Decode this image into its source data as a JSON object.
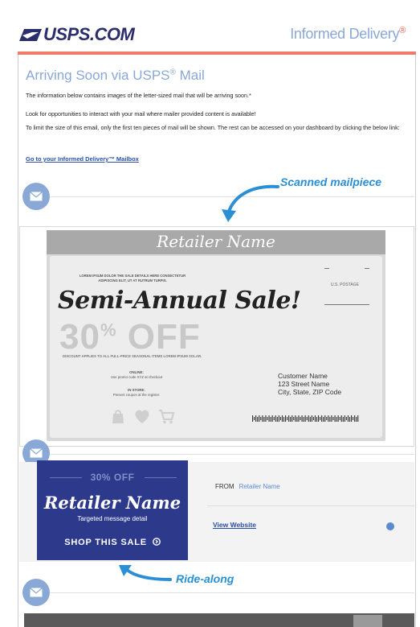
{
  "header": {
    "logo_text": "USPS.COM",
    "brand": "Informed Delivery",
    "brand_mark": "®"
  },
  "email": {
    "title": "Arriving Soon via USPS",
    "title_mark": "®",
    "title_suffix": " Mail",
    "paragraphs": [
      "The information below contains images of the letter-sized mail that will be arriving soon.*",
      "Look for opportunities to interact with your mail where mailer provided content is available!",
      "To limit the size of this email, only the first ten pieces of mail will be shown. The rest can be accessed on your dashboard by clicking the below link:"
    ],
    "mailbox_link": "Go to your Informed Delivery™ Mailbox"
  },
  "callouts": {
    "scanned": "Scanned mailpiece",
    "ridealong": "Ride-along"
  },
  "mailpiece": {
    "retailer_header": "Retailer Name",
    "lorem": "LOREM IPSUM DOLOR THE SALE DETAILS HERE CONSECTETUR ADIPISCING ELIT, UT AT RUTRUM TURPIS.",
    "headline": "Semi-Annual Sale!",
    "big_number": "30",
    "big_percent": "%",
    "big_off": " OFF",
    "discount": "DISCOUNT APPLIES TO ALL FULL-PRICE SEASONAL ITEMS LOREM IPSUM SOLAR.",
    "online_label": "ONLINE:",
    "online_text": "Use promo code XYZ at checkout",
    "instore_label": "IN STORE:",
    "instore_text": "Present coupon at the register.",
    "postage": "U.S. POSTAGE",
    "address_name": "Customer Name",
    "address_street": "123 Street Name",
    "address_city": "City, State, ZIP Code"
  },
  "ridealong": {
    "ad_off": "30% OFF",
    "ad_name": "Retailer Name",
    "ad_detail": "Targeted message detail",
    "ad_shop": "SHOP THIS SALE",
    "from_label": "FROM",
    "from_name": "Retailer Name",
    "view_website": "View Website"
  },
  "colors": {
    "accent": "#8aa8d6",
    "usps_navy": "#2b2e6b",
    "red_bar": "#f07b6a",
    "callout_blue": "#2a8fd4",
    "ad_navy": "#2d3a8c"
  },
  "icons": [
    "eagle-logo-icon",
    "mail-envelope-icon",
    "shopping-bag-icon",
    "heart-icon",
    "cart-icon",
    "arrow-circle-right-icon"
  ]
}
